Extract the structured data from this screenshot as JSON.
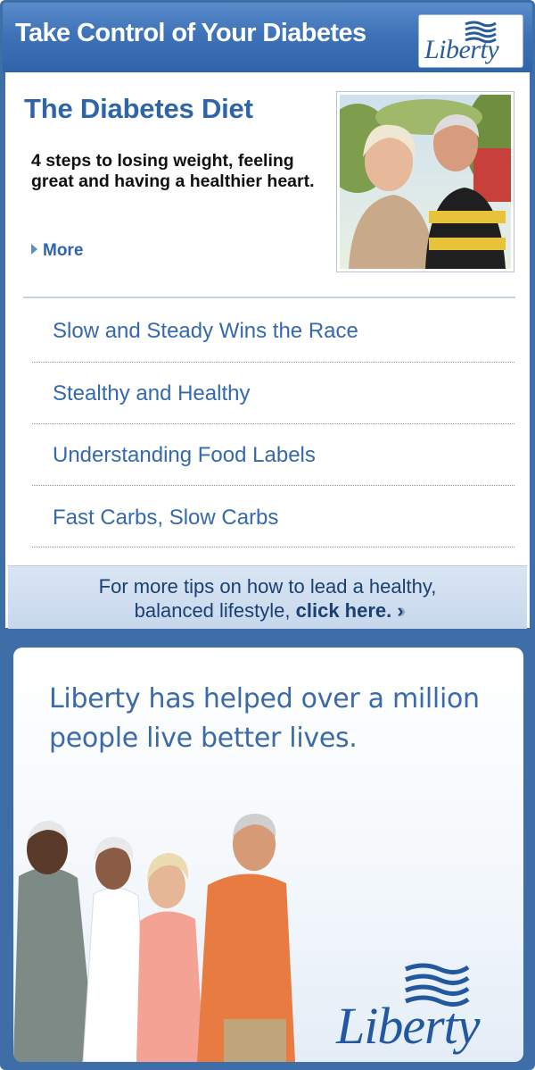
{
  "header": {
    "title": "Take Control of Your Diabetes",
    "logo_text": "Liberty"
  },
  "feature": {
    "title": "The Diabetes Diet",
    "description": "4 steps to losing weight, feeling great and having a healthier heart.",
    "more_label": "More"
  },
  "topics": [
    {
      "label": "Slow and Steady Wins the Race"
    },
    {
      "label": "Stealthy and Healthy"
    },
    {
      "label": "Understanding Food Labels"
    },
    {
      "label": "Fast Carbs, Slow Carbs"
    }
  ],
  "tips": {
    "line1": "For more tips on how to lead a healthy,",
    "line2_prefix": "balanced lifestyle,",
    "line2_link": "click here.",
    "chevrons": "›››"
  },
  "ad": {
    "headline": "Liberty has helped over a million people live better lives.",
    "logo_text": "Liberty"
  },
  "colors": {
    "brand_blue": "#2f64a9",
    "link_blue": "#3569ad",
    "tips_bg": "#d9e5f3"
  }
}
